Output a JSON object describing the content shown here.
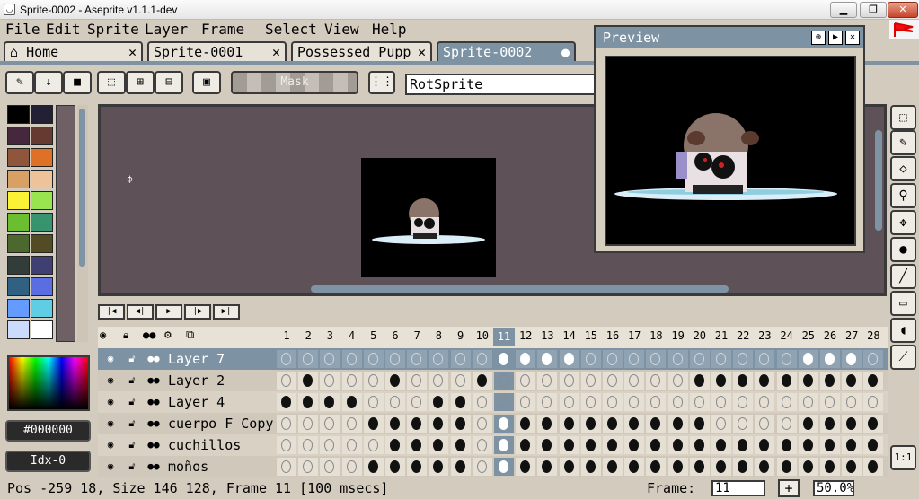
{
  "window": {
    "title": "Sprite-0002 - Aseprite v1.1.1-dev",
    "min": "▁",
    "max": "❐",
    "close": "✕"
  },
  "menu": [
    "File",
    "Edit",
    "Sprite",
    "Layer",
    "Frame",
    "Select",
    "View",
    "Help"
  ],
  "tabs": [
    {
      "label": "Home",
      "close": "✕"
    },
    {
      "label": "Sprite-0001",
      "close": "✕"
    },
    {
      "label": "Possessed Pupp",
      "close": "✕"
    },
    {
      "label": "Sprite-0002",
      "close": "●"
    }
  ],
  "toolbar": {
    "mask_label": "Mask",
    "rotation_algorithm": "RotSprite"
  },
  "preview": {
    "title": "Preview"
  },
  "color": {
    "hex": "#000000",
    "index": "Idx-0",
    "fg": "#000000",
    "bg": "#ffffff"
  },
  "palette": [
    "#000000",
    "#222034",
    "#45283c",
    "#663931",
    "#8f563b",
    "#df7126",
    "#d9a066",
    "#eec39a",
    "#fbf236",
    "#99e550",
    "#6abe30",
    "#37946e",
    "#4b692f",
    "#524b24",
    "#323c39",
    "#3f3f74",
    "#306082",
    "#5b6ee1",
    "#639bff",
    "#5fcde4",
    "#cbdbfc",
    "#ffffff"
  ],
  "frames": [
    "1",
    "2",
    "3",
    "4",
    "5",
    "6",
    "7",
    "8",
    "9",
    "10",
    "11",
    "12",
    "13",
    "14",
    "15",
    "16",
    "17",
    "18",
    "19",
    "20",
    "21",
    "22",
    "23",
    "24",
    "25",
    "26",
    "27",
    "28"
  ],
  "current_frame_index": 10,
  "layers": [
    {
      "name": "Layer 7",
      "active": true,
      "cels": "eeeeeeeeeeFFFFeeeeeeeeeeFFFe"
    },
    {
      "name": "Layer 2",
      "active": false,
      "cels": "eFeeeFeeeFeeeeeeeeeFFFFFFFFF"
    },
    {
      "name": "Layer 4",
      "active": false,
      "cels": "FFFFeeeFFeeeeeeeeeeeeeeeeeee"
    },
    {
      "name": "cuerpo F Copy",
      "active": false,
      "cels": "eeeeFFFFFeWFFFFFFFFFeeeeFFFF"
    },
    {
      "name": "cuchillos",
      "active": false,
      "cels": "eeeeeFFFFeWFFFFFFFFFFFFFFFFF"
    },
    {
      "name": "moños",
      "active": false,
      "cels": "eeeeFFFFFeWFFFFFFFFFFFFFFFFF"
    }
  ],
  "status": {
    "text": "Pos -259 18, Size 146 128, Frame 11 [100 msecs]",
    "frame_label": "Frame:",
    "frame_value": "11",
    "plus": "+",
    "zoom": "50.0%"
  },
  "tools_zoom_label": "1:1"
}
